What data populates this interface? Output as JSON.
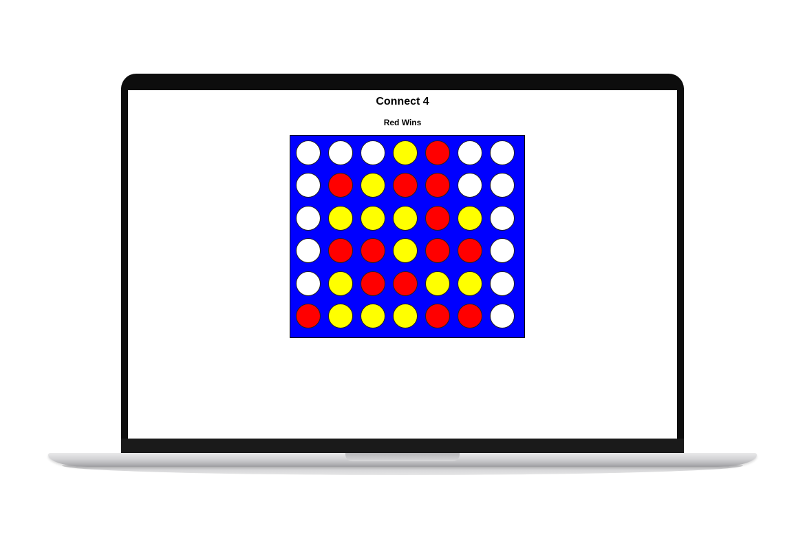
{
  "game": {
    "title": "Connect 4",
    "status": "Red Wins"
  },
  "colors": {
    "board": "#0000ff",
    "empty": "#ffffff",
    "red": "#ff0000",
    "yellow": "#ffff00"
  },
  "board": {
    "rows": 6,
    "columns": 7,
    "cells": [
      [
        "empty",
        "empty",
        "empty",
        "yellow",
        "red",
        "empty",
        "empty"
      ],
      [
        "empty",
        "red",
        "yellow",
        "red",
        "red",
        "empty",
        "empty"
      ],
      [
        "empty",
        "yellow",
        "yellow",
        "yellow",
        "red",
        "yellow",
        "empty"
      ],
      [
        "empty",
        "red",
        "red",
        "yellow",
        "red",
        "red",
        "empty"
      ],
      [
        "empty",
        "yellow",
        "red",
        "red",
        "yellow",
        "yellow",
        "empty"
      ],
      [
        "red",
        "yellow",
        "yellow",
        "yellow",
        "red",
        "red",
        "empty"
      ]
    ]
  }
}
